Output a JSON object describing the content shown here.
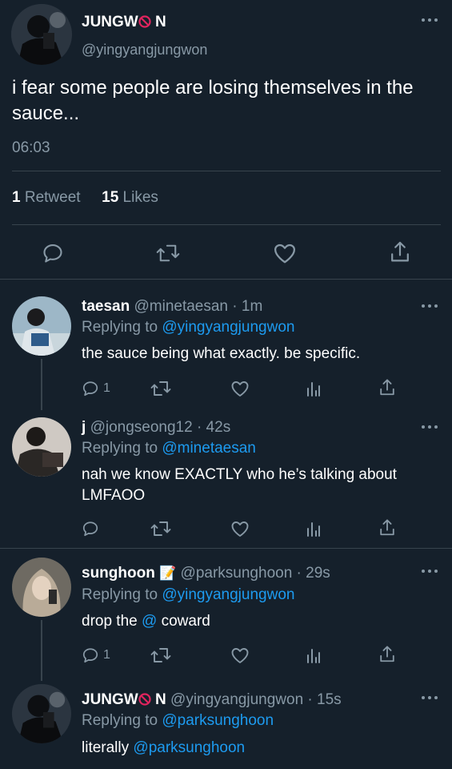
{
  "main_tweet": {
    "name_left": "JUNGW",
    "name_right": "N",
    "handle": "@yingyangjungwon",
    "text": "i fear some people are losing themselves in the sauce...",
    "time": "06:03",
    "retweet_count": "1",
    "retweet_label": "Retweet",
    "like_count": "15",
    "like_label": "Likes"
  },
  "replies": [
    {
      "name": "taesan",
      "handle_time": "@minetaesan · 1m",
      "replying_label": "Replying to",
      "replying_to": "@yingyangjungwon",
      "text": "the sauce being what exactly. be specific.",
      "reply_count": "1"
    },
    {
      "name": "j",
      "handle_time": "@jongseong12 · 42s",
      "replying_label": "Replying to",
      "replying_to": "@minetaesan",
      "text_line1": "nah we know EXACTLY who he’s talking about",
      "text_line2": "LMFAOO"
    },
    {
      "name": "sunghoon",
      "emoji": "📝",
      "handle_time": "@parksunghoon · 29s",
      "replying_label": "Replying to",
      "replying_to": "@yingyangjungwon",
      "text_before": "drop the",
      "text_mention": "@",
      "text_after": "coward",
      "reply_count": "1"
    },
    {
      "name_left": "JUNGW",
      "name_right": "N",
      "handle_time": "@yingyangjungwon · 15s",
      "replying_label": "Replying to",
      "replying_to": "@parksunghoon",
      "text_before": "literally",
      "text_mention": "@parksunghoon"
    }
  ],
  "icons": {
    "reply": "reply-icon",
    "retweet": "retweet-icon",
    "like": "heart-icon",
    "share": "share-icon",
    "analytics": "analytics-icon",
    "more": "more-icon"
  },
  "colors": {
    "background": "#15202b",
    "muted": "#8899a6",
    "link": "#1d9bf0",
    "divider": "#38444d"
  }
}
